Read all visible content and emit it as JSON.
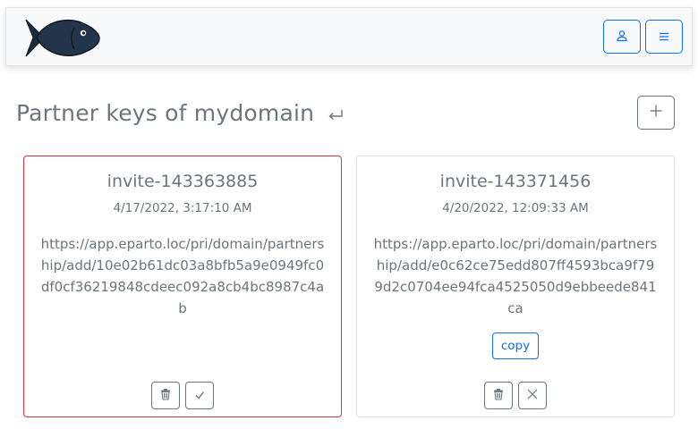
{
  "header": {
    "logo_icon": "fish-logo-icon",
    "buttons": [
      {
        "icon": "person-icon"
      },
      {
        "icon": "hamburger-menu-icon"
      }
    ]
  },
  "page": {
    "title": "Partner keys of mydomain",
    "return_icon": "return-arrow-icon",
    "add_icon": "plus-icon"
  },
  "cards": [
    {
      "name": "invite-143363885",
      "date": "4/17/2022, 3:17:10 AM",
      "url": "https://app.eparto.loc/pri/domain/partnership/add/10e02b61dc03a8bfb5a9e0949fc0df0cf36219848cdeec092a8cb4bc8987c4ab",
      "highlight_color": "#dc3545",
      "actions": [
        "trash-icon",
        "check-icon"
      ]
    },
    {
      "name": "invite-143371456",
      "date": "4/20/2022, 12:09:33 AM",
      "url": "https://app.eparto.loc/pri/domain/partnership/add/e0c62ce75edd807ff4593bca9f799d2c0704ee94fca4525050d9ebbeede841ca",
      "copy_label": "copy",
      "actions": [
        "trash-icon",
        "x-icon"
      ]
    }
  ],
  "colors": {
    "primary": "#0d6efd",
    "secondary": "#6c757d",
    "danger": "#dc3545",
    "navbar_bg": "#f8f9fa"
  }
}
